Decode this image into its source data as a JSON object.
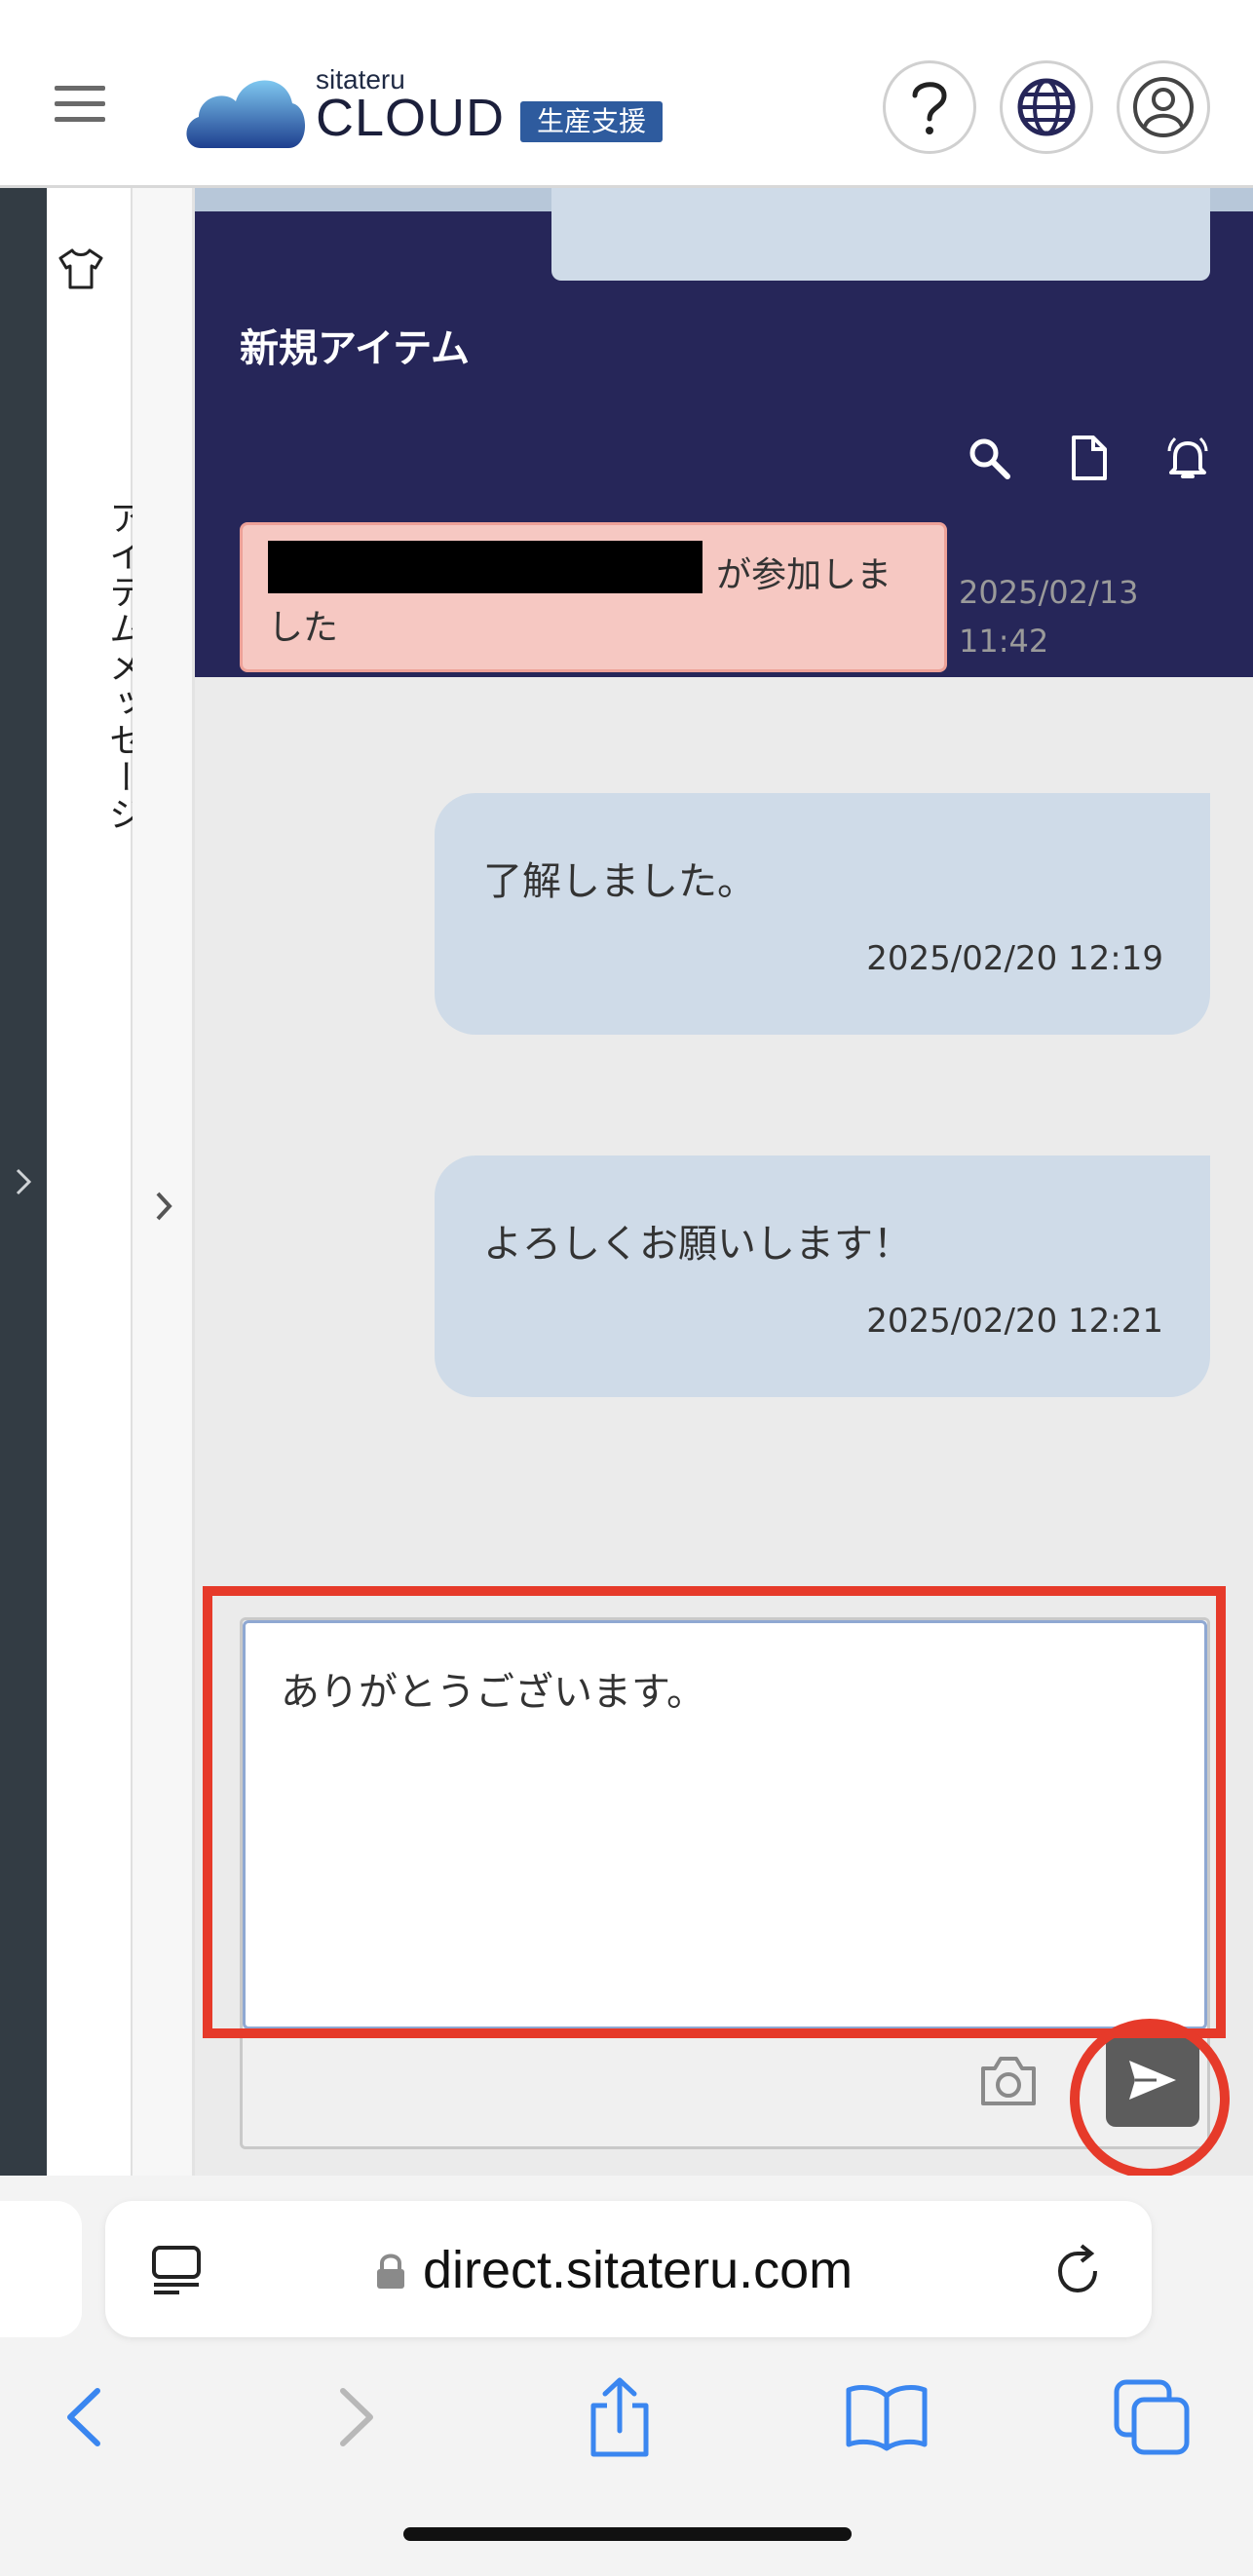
{
  "header": {
    "logo_small": "sitateru",
    "logo_big": "CLOUD",
    "logo_badge": "生産支援"
  },
  "sidebar": {
    "vertical_tab_label": "アイテムメッセージ"
  },
  "item": {
    "title": "新規アイテム"
  },
  "messages": {
    "system": {
      "text_line1": "が参加しま",
      "text_line2": "した",
      "date": "2025/02/13",
      "time": "11:42"
    },
    "bubbles": [
      {
        "text": "了解しました。",
        "timestamp": "2025/02/20 12:19"
      },
      {
        "text": "よろしくお願いします！",
        "timestamp": "2025/02/20 12:21"
      }
    ]
  },
  "compose": {
    "value": "ありがとうございます。"
  },
  "browser": {
    "url": "direct.sitateru.com"
  },
  "colors": {
    "header_navy": "#262659",
    "bubble": "#cfdbe8",
    "system_bg": "#f6c8c2",
    "annotation_red": "#e63a2a",
    "safari_blue": "#3a86f0"
  }
}
